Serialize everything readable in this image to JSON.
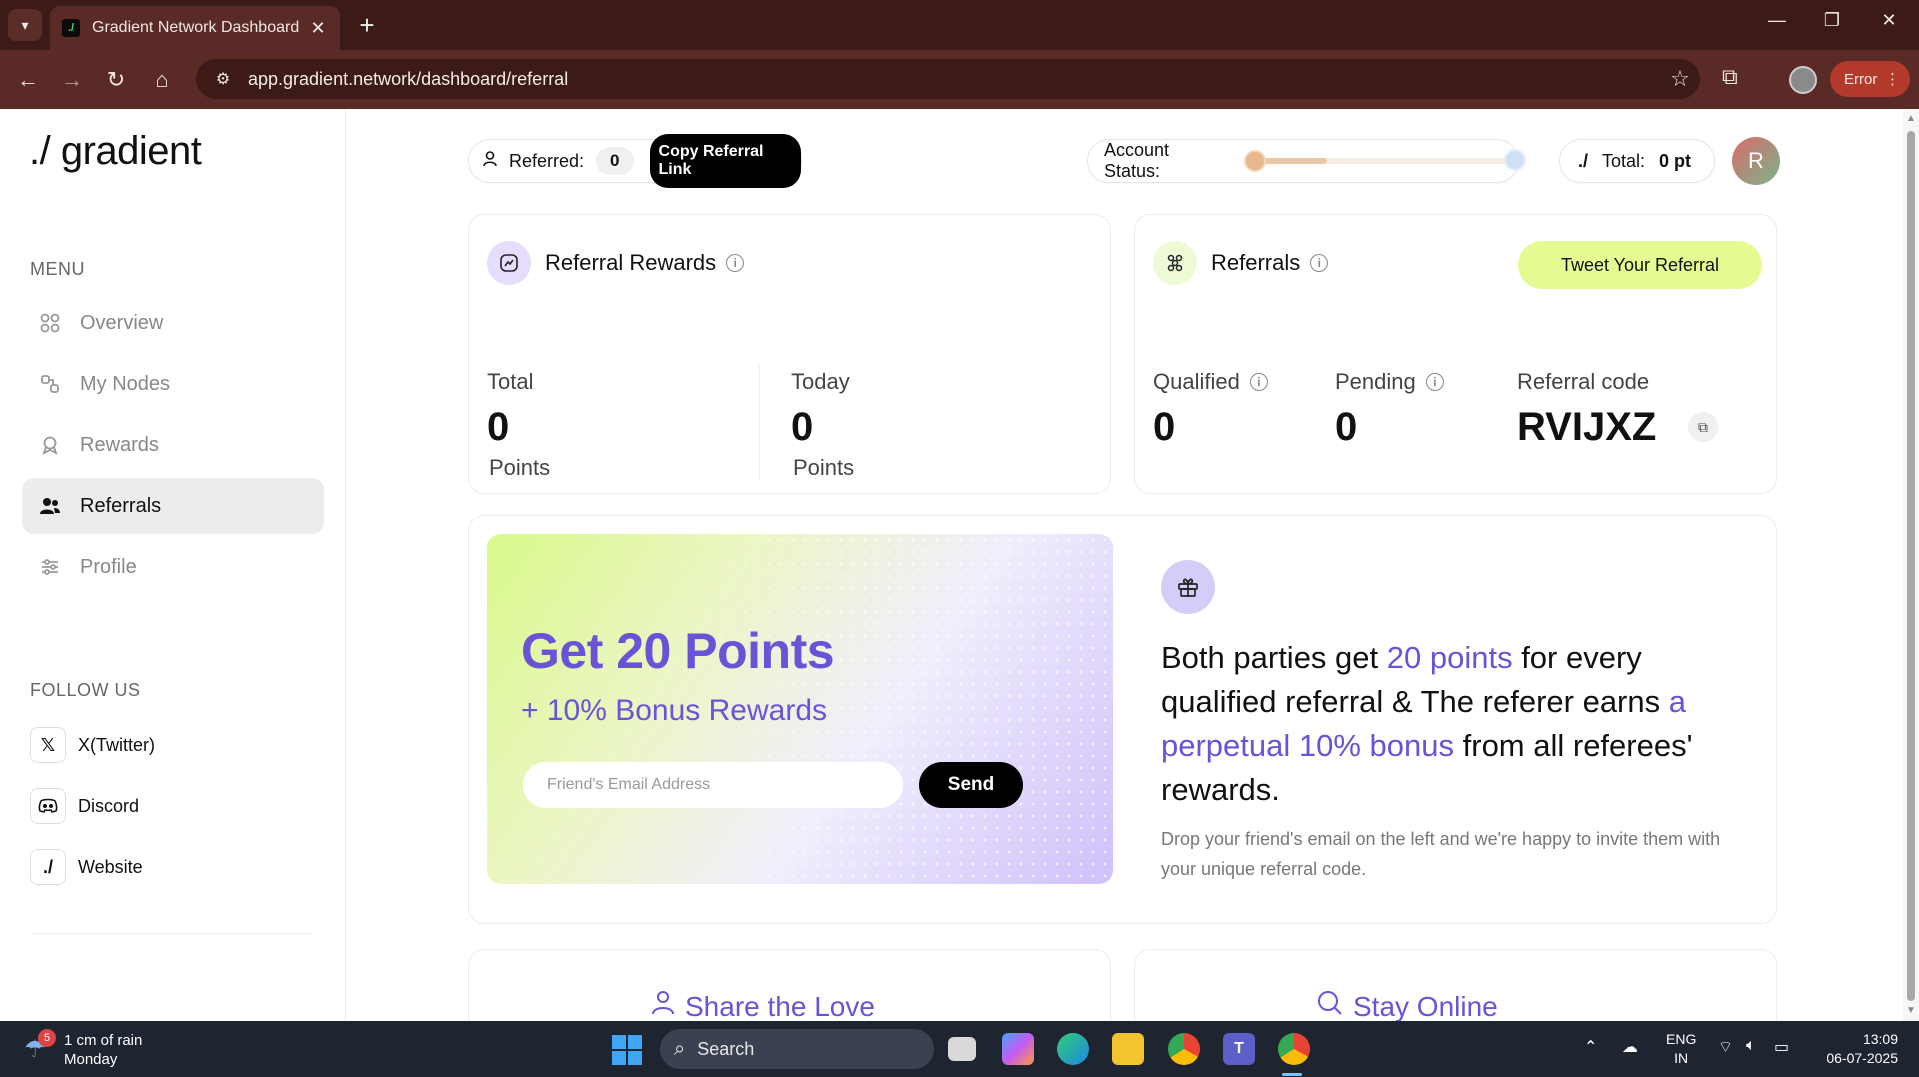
{
  "browser": {
    "tab_title": "Gradient Network Dashboard",
    "url": "app.gradient.network/dashboard/referral",
    "error_label": "Error",
    "icons": [
      "tab-search-icon",
      "close-icon",
      "plus-icon",
      "minimize-icon",
      "restore-icon",
      "back-icon",
      "forward-icon",
      "reload-icon",
      "home-icon",
      "site-settings-icon",
      "star-icon",
      "extensions-icon",
      "profile-icon",
      "more-icon"
    ]
  },
  "sidebar": {
    "logo": "./ gradient",
    "menu_label": "MENU",
    "menu_items": [
      {
        "label": "Overview",
        "icon": "grid-icon",
        "active": false
      },
      {
        "label": "My Nodes",
        "icon": "nodes-icon",
        "active": false
      },
      {
        "label": "Rewards",
        "icon": "award-icon",
        "active": false
      },
      {
        "label": "Referrals",
        "icon": "users-icon",
        "active": true
      },
      {
        "label": "Profile",
        "icon": "sliders-icon",
        "active": false
      }
    ],
    "follow_label": "FOLLOW US",
    "follow_items": [
      {
        "label": "X(Twitter)",
        "icon": "x-icon"
      },
      {
        "label": "Discord",
        "icon": "discord-icon"
      },
      {
        "label": "Website",
        "icon": "gradient-icon"
      }
    ]
  },
  "header": {
    "referred_label": "Referred:",
    "referred_count": "0",
    "copy_link_label": "Copy Referral Link",
    "account_status_label": "Account Status:",
    "account_status_progress": 0.28,
    "total_label": "Total:",
    "total_value": "0 pt",
    "avatar_initial": "R"
  },
  "referral_rewards": {
    "title": "Referral Rewards",
    "total_label": "Total",
    "total_value": "0",
    "total_unit": "Points",
    "today_label": "Today",
    "today_value": "0",
    "today_unit": "Points"
  },
  "referrals": {
    "title": "Referrals",
    "tweet_button": "Tweet Your Referral",
    "qualified_label": "Qualified",
    "qualified_value": "0",
    "pending_label": "Pending",
    "pending_value": "0",
    "code_label": "Referral code",
    "code_value": "RVIJXZ"
  },
  "promo": {
    "title": "Get 20 Points",
    "subtitle": "+ 10% Bonus Rewards",
    "email_placeholder": "Friend's Email Address",
    "send_label": "Send",
    "text_1": "Both parties get ",
    "text_hl_1": "20 points",
    "text_2": " for every qualified referral & The referer earns ",
    "text_hl_2": "a perpetual 10% bonus",
    "text_3": " from all referees' rewards.",
    "note": "Drop your friend's email on the left and we're happy to invite them with your unique referral code."
  },
  "bottom_cards": {
    "share_title": "Share the Love",
    "online_title": "Stay Online"
  },
  "taskbar": {
    "weather_badge": "5",
    "weather_line1": "1 cm of rain",
    "weather_line2": "Monday",
    "search_label": "Search",
    "lang_line1": "ENG",
    "lang_line2": "IN",
    "time": "13:09",
    "date": "06-07-2025"
  },
  "colors": {
    "accent_purple": "#6a53d6",
    "lime": "#e4fb92",
    "chrome_dark": "#3b1a18",
    "chrome_toolbar": "#5a2b26",
    "error_red": "#b33a2b"
  }
}
